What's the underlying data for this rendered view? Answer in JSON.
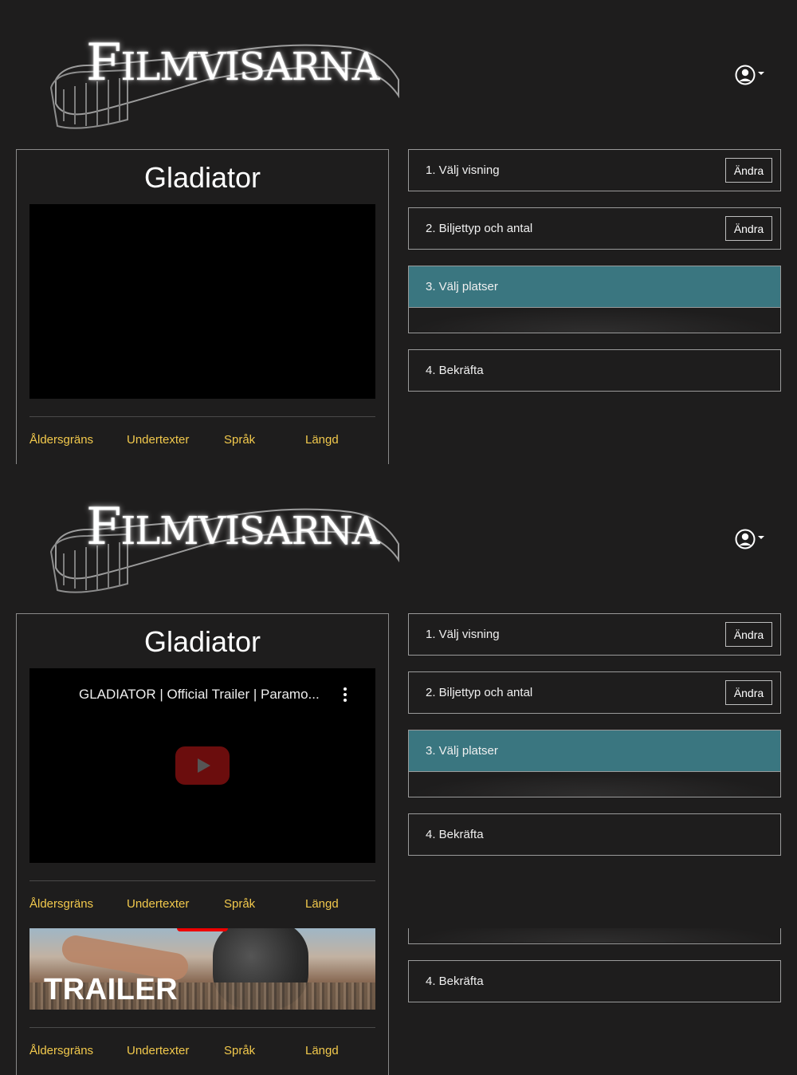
{
  "brand": {
    "logo_text_big": "F",
    "logo_text_rest": "ILMVISARNA"
  },
  "movie": {
    "title": "Gladiator",
    "trailer_title": "GLADIATOR | Official Trailer | Paramo...",
    "trailer_overlay": "TRAILER",
    "info_labels": [
      "Åldersgräns",
      "Undertexter",
      "Språk",
      "Längd"
    ]
  },
  "steps": [
    {
      "label": "1. Välj visning",
      "action": "Ändra"
    },
    {
      "label": "2. Biljettyp och antal",
      "action": "Ändra"
    },
    {
      "label": "3. Välj platser",
      "active": true
    },
    {
      "label": "4. Bekräfta"
    }
  ],
  "colors": {
    "background": "#1e1d1d",
    "active_step": "#3a7680",
    "info_label": "#f2c94c"
  }
}
